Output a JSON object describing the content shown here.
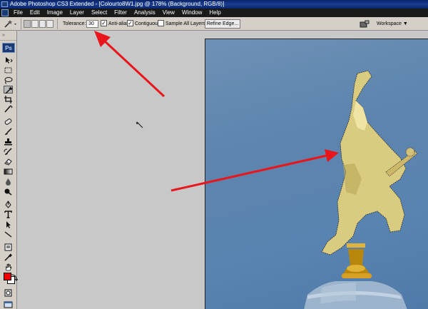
{
  "window": {
    "title": "Adobe Photoshop CS3 Extended - [Colourto8W1.jpg @ 178% (Background, RGB/8)]"
  },
  "menu": [
    "File",
    "Edit",
    "Image",
    "Layer",
    "Select",
    "Filter",
    "Analysis",
    "View",
    "Window",
    "Help"
  ],
  "options": {
    "tolerance_label": "Tolerance:",
    "tolerance_value": "30",
    "antialias_label": "Anti-alias",
    "antialias_checked": true,
    "contiguous_label": "Contiguous",
    "contiguous_checked": true,
    "sample_all_label": "Sample All Layers",
    "sample_all_checked": false,
    "refine_edge_label": "Refine Edge...",
    "workspace_label": "Workspace"
  },
  "toolbox": {
    "logo": "Ps",
    "active_tool": "magic-wand",
    "foreground_color": "#f20000",
    "background_color": "#ffffff",
    "tools": [
      "move",
      "marquee",
      "lasso",
      "magic-wand",
      "crop",
      "slice",
      "healing-brush",
      "brush",
      "clone-stamp",
      "history-brush",
      "eraser",
      "gradient",
      "blur",
      "dodge",
      "pen",
      "type",
      "path-selection",
      "line",
      "notes",
      "eyedropper",
      "hand",
      "zoom"
    ]
  },
  "colors": {
    "annotation_arrow": "#e8161b",
    "sky": "#5d85ae",
    "statue": "#d7c77a"
  }
}
